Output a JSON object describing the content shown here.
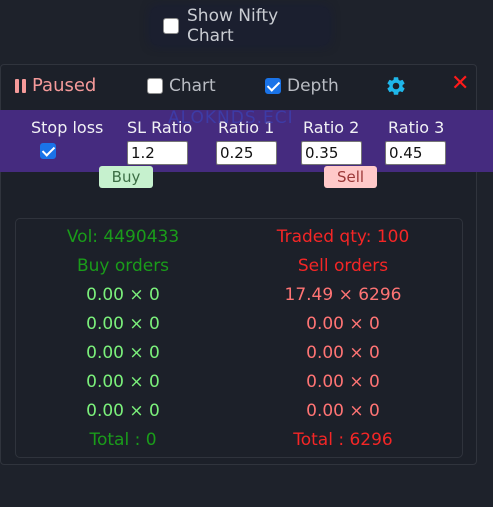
{
  "top": {
    "show_nifty_label": "Show Nifty Chart",
    "show_nifty_checked": false
  },
  "toolbar": {
    "paused_label": "Paused",
    "chart_label": "Chart",
    "chart_checked": false,
    "depth_label": "Depth",
    "depth_checked": true,
    "settings_icon": "gear-icon",
    "close_icon": "close-icon",
    "close_glyph": "✕"
  },
  "ratios": {
    "stop_loss_label": "Stop loss",
    "stop_loss_checked": true,
    "sl_ratio_label": "SL Ratio",
    "sl_ratio_value": "1.2",
    "ratio1_label": "Ratio 1",
    "ratio1_value": "0.25",
    "ratio2_label": "Ratio 2",
    "ratio2_value": "0.35",
    "ratio3_label": "Ratio 3",
    "ratio3_value": "0.45",
    "watermark": "ALOKNDS.ECI"
  },
  "actions": {
    "buy_label": "Buy",
    "sell_label": "Sell"
  },
  "colors": {
    "accent_band": "#452b7f",
    "buy_green": "#7bf07b",
    "sell_red": "#ff7474",
    "close_red": "#ff1a1a",
    "gear_cyan": "#1fb7ea"
  },
  "book": {
    "vol_label": "Vol: 4490433",
    "traded_qty_label": "Traded qty: 100",
    "buy_header": "Buy orders",
    "sell_header": "Sell orders",
    "buy_orders": [
      "0.00 × 0",
      "0.00 × 0",
      "0.00 × 0",
      "0.00 × 0",
      "0.00 × 0"
    ],
    "sell_orders": [
      "17.49 × 6296",
      "0.00 × 0",
      "0.00 × 0",
      "0.00 × 0",
      "0.00 × 0"
    ],
    "buy_total": "Total : 0",
    "sell_total": "Total : 6296"
  }
}
